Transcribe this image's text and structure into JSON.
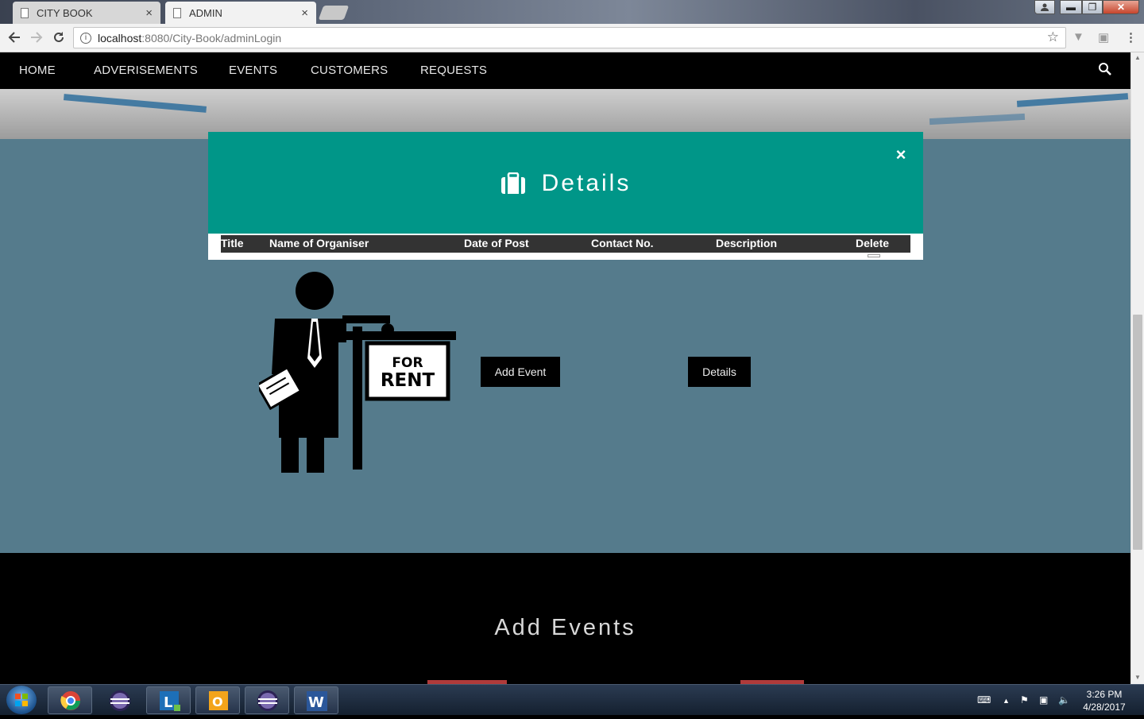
{
  "browser": {
    "tabs": [
      {
        "label": "CITY BOOK"
      },
      {
        "label": "ADMIN"
      }
    ],
    "tab_close": "×",
    "address": {
      "host": "localhost",
      "path": ":8080/City-Book/adminLogin"
    },
    "window_buttons": {
      "min": "▬",
      "max": "❐",
      "close": "✕"
    }
  },
  "nav": {
    "items": [
      "HOME",
      "ADVERISEMENTS",
      "EVENTS",
      "CUSTOMERS",
      "REQUESTS"
    ]
  },
  "content": {
    "add_event_button": "Add Event",
    "details_button": "Details",
    "sign_text_top": "FOR",
    "sign_text_bottom": "RENT"
  },
  "modal": {
    "title": "Details",
    "close": "×",
    "columns": [
      "Title",
      "Name of Organiser",
      "Date of Post",
      "Contact No.",
      "Description",
      "Delete"
    ]
  },
  "section_below": {
    "title": "Add Events"
  },
  "taskbar": {
    "time": "3:26 PM",
    "date": "4/28/2017"
  },
  "colors": {
    "modal_header": "#009688",
    "section_bg": "#557b8c",
    "nav_bg": "#000000"
  },
  "icons": [
    "briefcase-icon",
    "search-icon",
    "close-icon",
    "star-icon",
    "info-icon",
    "back-icon",
    "forward-icon",
    "reload-icon"
  ]
}
